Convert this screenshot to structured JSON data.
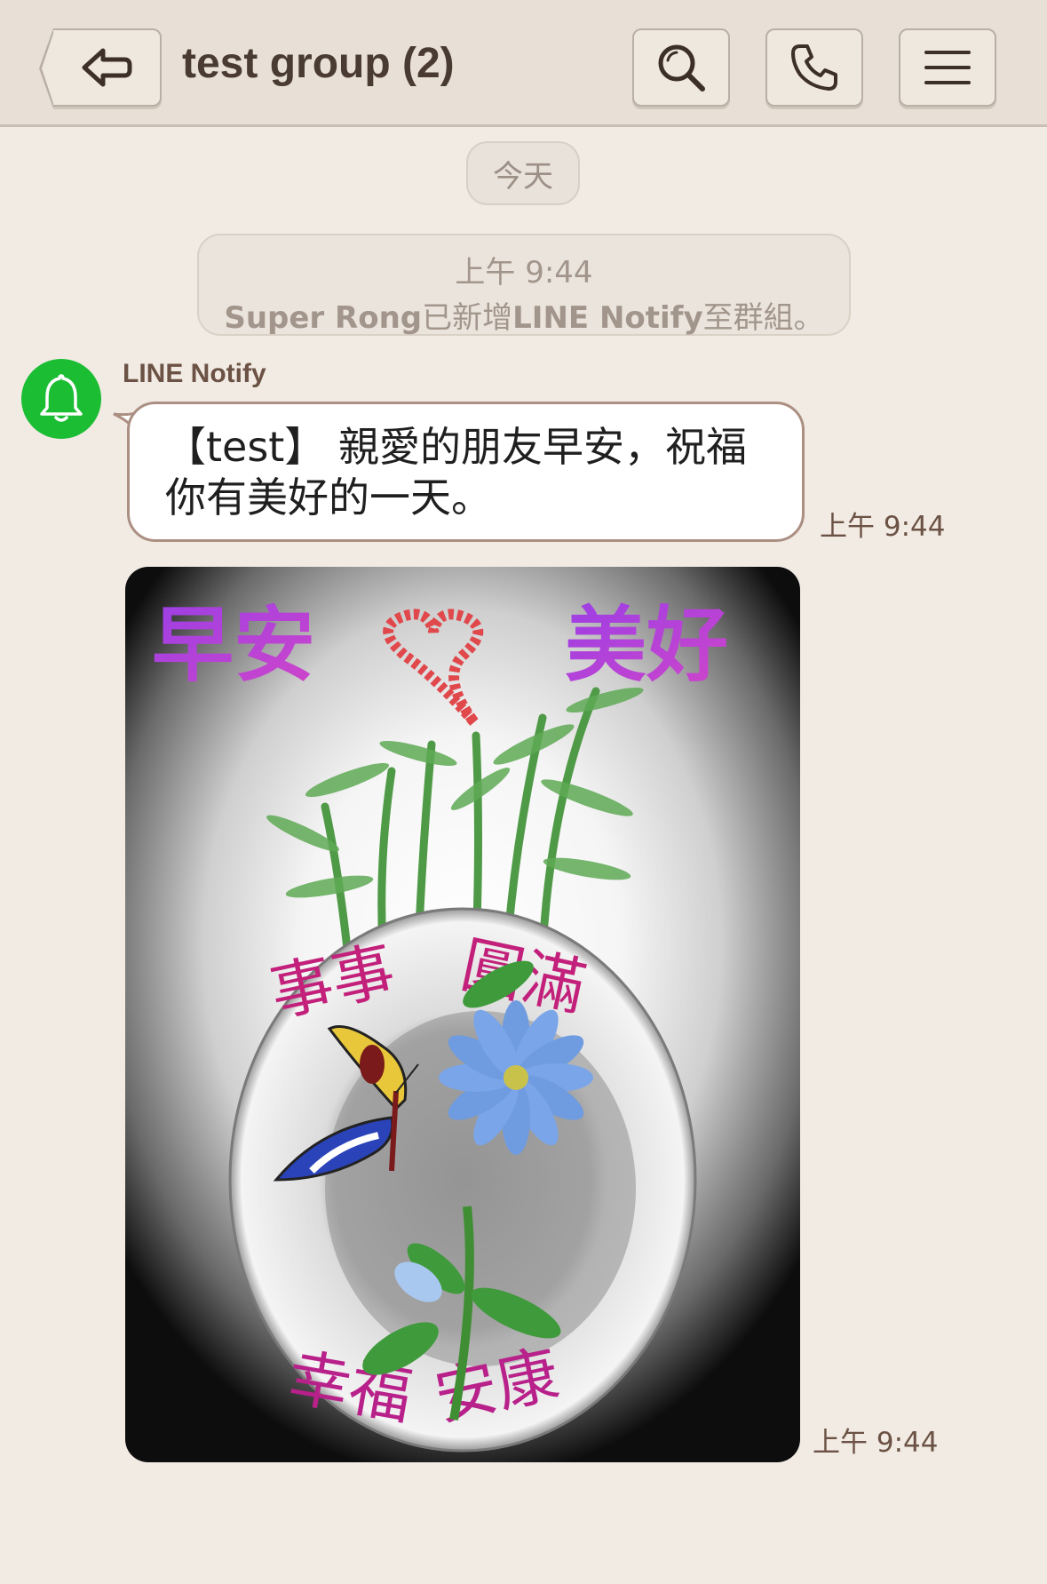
{
  "header": {
    "title": "test group (2)",
    "back_icon": "back-arrow-icon",
    "search_icon": "search-icon",
    "call_icon": "phone-icon",
    "menu_icon": "menu-icon"
  },
  "chat": {
    "date_separator": "今天",
    "system_message": {
      "time": "上午 9:44",
      "actor": "Super Rong",
      "action_prefix": "已新增",
      "subject": "LINE Notify",
      "action_suffix": "至群組。"
    },
    "messages": [
      {
        "sender": "LINE Notify",
        "avatar_icon": "bell-icon",
        "avatar_color": "#1bbd33",
        "text": "【test】 親愛的朋友早安，祝福你有美好的一天。",
        "time": "上午 9:44"
      },
      {
        "type": "image",
        "image_description_icon": "greeting-card-image",
        "image_text": {
          "top_left": "早安",
          "top_right": "美好",
          "plate_top_left": "事事",
          "plate_top_right": "圓滿",
          "plate_bottom_left": "幸福",
          "plate_bottom_right": "安康"
        },
        "time": "上午 9:44"
      }
    ]
  },
  "colors": {
    "background": "#f2ebe4",
    "header": "#e8e0d6",
    "accent_green": "#1bbd33"
  }
}
